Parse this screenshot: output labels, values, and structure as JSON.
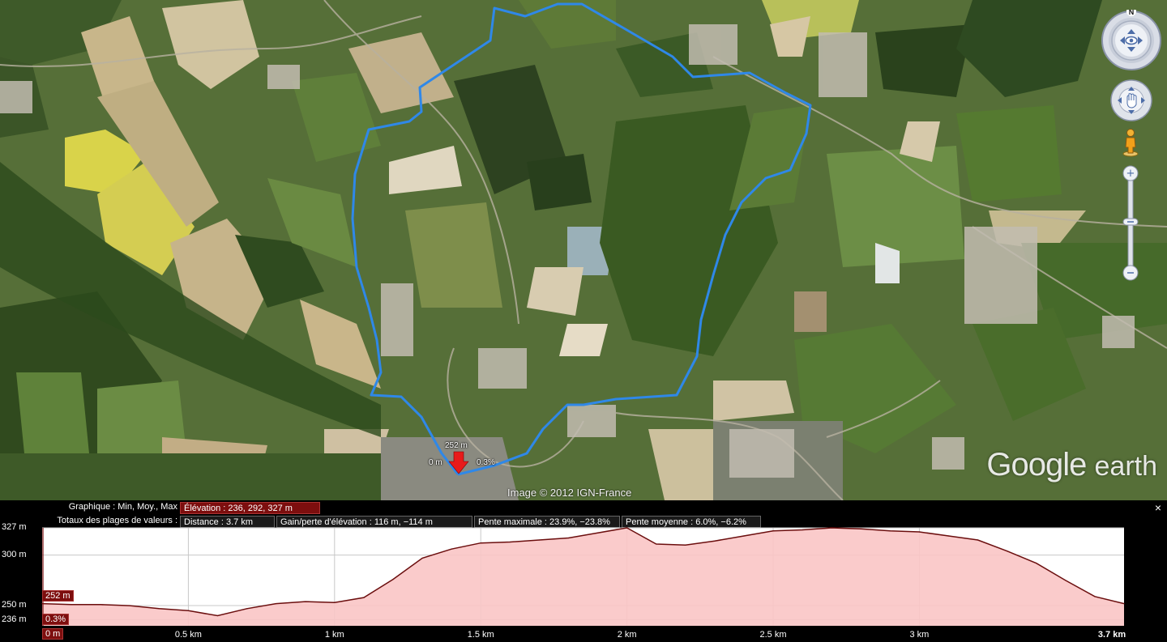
{
  "map": {
    "copyright": "Image © 2012 IGN-France",
    "brand_google": "Google",
    "brand_earth": "earth",
    "compass_north": "N",
    "marker": {
      "elevation": "252 m",
      "distance": "0 m",
      "slope": "0.3%"
    }
  },
  "panel": {
    "row1_label": "Graphique : Min, Moy., Max",
    "elevation_summary": "Élévation : 236, 292, 327 m",
    "row2_label": "Totaux des plages de valeurs :",
    "distance": "Distance : 3.7 km",
    "gain_loss": "Gain/perte d'élévation : 116 m, −114 m",
    "max_slope": "Pente maximale : 23.9%, −23.8%",
    "avg_slope": "Pente moyenne : 6.0%, −6.2%",
    "close": "×"
  },
  "chart_data": {
    "type": "area",
    "x": [
      0,
      0.1,
      0.2,
      0.3,
      0.4,
      0.5,
      0.6,
      0.7,
      0.8,
      0.9,
      1.0,
      1.1,
      1.2,
      1.3,
      1.4,
      1.5,
      1.6,
      1.7,
      1.8,
      1.9,
      2.0,
      2.1,
      2.2,
      2.3,
      2.4,
      2.5,
      2.6,
      2.7,
      2.8,
      2.9,
      3.0,
      3.1,
      3.2,
      3.3,
      3.4,
      3.5,
      3.6,
      3.7
    ],
    "y": [
      252,
      251,
      251,
      250,
      247,
      245,
      240,
      247,
      252,
      254,
      253,
      258,
      276,
      297,
      306,
      312,
      313,
      315,
      317,
      322,
      327,
      311,
      310,
      314,
      319,
      324,
      325,
      327,
      326,
      324,
      323,
      319,
      315,
      304,
      292,
      275,
      259,
      252
    ],
    "xlabel": "",
    "ylabel": "",
    "xlim": [
      0,
      3.7
    ],
    "ylim": [
      230,
      327
    ],
    "x_ticks": [
      "0 m",
      "0.5 km",
      "1 km",
      "1.5 km",
      "2 km",
      "2.5 km",
      "3 km",
      "3.7 km"
    ],
    "x_tick_values": [
      0,
      0.5,
      1,
      1.5,
      2,
      2.5,
      3,
      3.7
    ],
    "y_ticks": [
      "327 m",
      "300 m",
      "250 m",
      "236 m"
    ],
    "y_tick_values": [
      327,
      300,
      250,
      236
    ],
    "cursor_elevation": "252 m",
    "cursor_slope": "0.3%",
    "grid": true,
    "colors": {
      "line": "#6b0e0e",
      "fill": "#f9c5c5",
      "background": "#ffffff"
    }
  },
  "colors": {
    "track": "#2f88e8",
    "marker": "#e81b1b",
    "panel_accent": "#7d0e0e"
  }
}
